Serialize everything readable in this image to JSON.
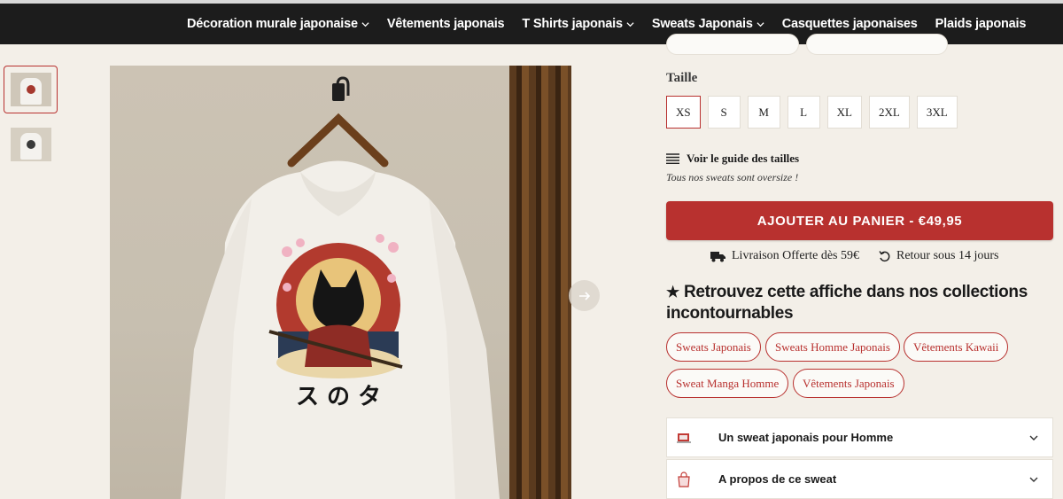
{
  "nav": {
    "items": [
      {
        "label": "Décoration murale japonaise",
        "has_dropdown": true
      },
      {
        "label": "Vêtements japonais",
        "has_dropdown": false
      },
      {
        "label": "T Shirts japonais",
        "has_dropdown": true
      },
      {
        "label": "Sweats Japonais",
        "has_dropdown": true
      },
      {
        "label": "Casquettes japonaises",
        "has_dropdown": false
      },
      {
        "label": "Plaids japonais",
        "has_dropdown": false
      }
    ]
  },
  "product": {
    "size_label": "Taille",
    "sizes": [
      "XS",
      "S",
      "M",
      "L",
      "XL",
      "2XL",
      "3XL"
    ],
    "selected_size": "XS",
    "size_guide": "Voir le guide des tailles",
    "oversize_note": "Tous nos sweats sont oversize !",
    "add_to_cart": "AJOUTER AU PANIER - €49,95",
    "shipping": "Livraison Offerte dès 59€",
    "returns": "Retour sous 14 jours"
  },
  "collections": {
    "title": "Retrouvez cette affiche dans nos collections incontournables",
    "tags": [
      "Sweats Japonais",
      "Sweats Homme Japonais",
      "Vêtements Kawaii",
      "Sweat Manga Homme",
      "Vêtements Japonais"
    ]
  },
  "accordion": [
    {
      "label": "Un sweat japonais pour Homme",
      "icon": "shirt-icon"
    },
    {
      "label": "A propos de ce sweat",
      "icon": "shopping-bag-icon"
    }
  ],
  "colors": {
    "accent": "#b8312f",
    "nav_bg": "#1c1c1c",
    "page_bg": "#f3efe8"
  }
}
